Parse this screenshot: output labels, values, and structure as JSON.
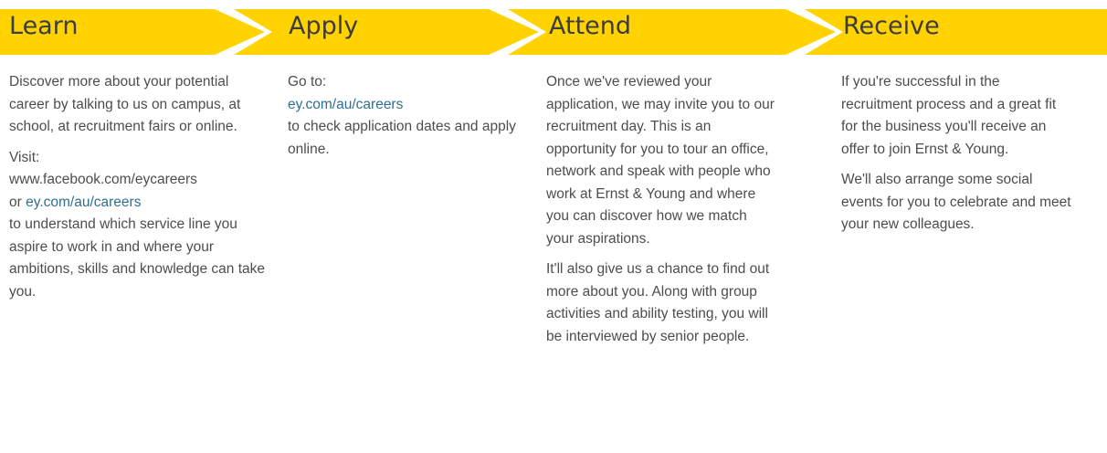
{
  "colors": {
    "band": "#ffd200",
    "link": "#2e6f93",
    "text": "#4d4d4d"
  },
  "steps": [
    {
      "title": "Learn",
      "para1": "Discover more about your potential career by talking to us on campus, at school, at recruitment fairs or online.",
      "visit_label": "Visit:",
      "facebook": "www.facebook.com/eycareers",
      "or": "or",
      "link": "ey.com/au/careers",
      "para2": "to understand which service line you aspire to work in and where your ambitions, skills and knowledge can take you."
    },
    {
      "title": "Apply",
      "goto": "Go to:",
      "link": "ey.com/au/careers",
      "para": "to check application dates and apply online."
    },
    {
      "title": "Attend",
      "para1": "Once we've reviewed your application, we may invite you to our recruitment day. This is an opportunity for you to tour an office, network and speak with people who work at Ernst & Young and where you can discover how we match your aspirations.",
      "para2": "It'll also give us a chance to find out more about you. Along with group activities and ability testing, you will be interviewed by senior people."
    },
    {
      "title": "Receive",
      "para1": "If you're successful in the recruitment process and a great fit for the business you'll receive an offer to join Ernst & Young.",
      "para2": "We'll also arrange some social events for you to celebrate and meet your new colleagues."
    }
  ]
}
